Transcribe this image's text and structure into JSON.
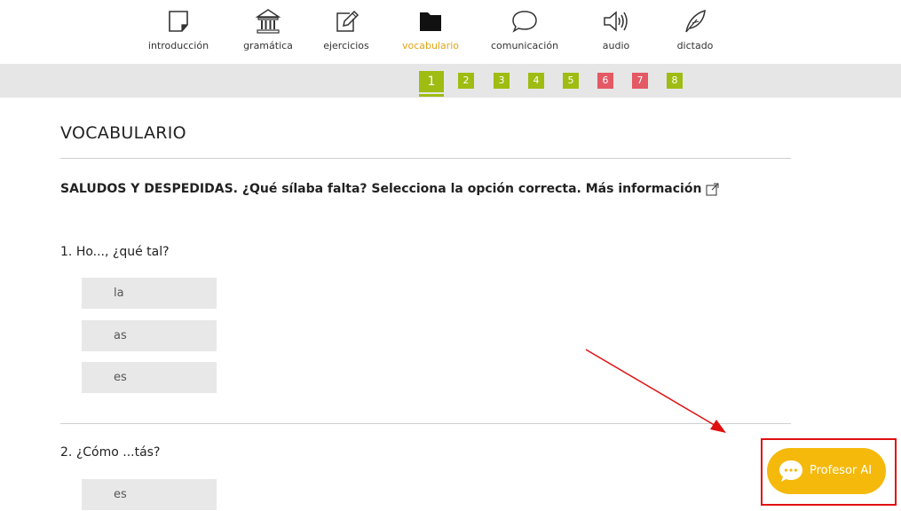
{
  "nav": {
    "items": [
      {
        "label": "introducción",
        "icon": "note-icon",
        "active": false
      },
      {
        "label": "gramática",
        "icon": "building-icon",
        "active": false
      },
      {
        "label": "ejercicios",
        "icon": "pen-icon",
        "active": false
      },
      {
        "label": "vocabulario",
        "icon": "folder-icon",
        "active": true
      },
      {
        "label": "comunicación",
        "icon": "speech-bubble-icon",
        "active": false
      },
      {
        "label": "audio",
        "icon": "speaker-icon",
        "active": false
      },
      {
        "label": "dictado",
        "icon": "feather-icon",
        "active": false
      }
    ]
  },
  "pager": {
    "pages": [
      {
        "label": "1",
        "status": "current"
      },
      {
        "label": "2",
        "status": "green"
      },
      {
        "label": "3",
        "status": "green"
      },
      {
        "label": "4",
        "status": "green"
      },
      {
        "label": "5",
        "status": "green"
      },
      {
        "label": "6",
        "status": "red"
      },
      {
        "label": "7",
        "status": "red"
      },
      {
        "label": "8",
        "status": "green"
      }
    ]
  },
  "content": {
    "title": "VOCABULARIO",
    "instruction": "SALUDOS Y DESPEDIDAS. ¿Qué sílaba falta? Selecciona la opción correcta. Más información",
    "questions": [
      {
        "number": "1.",
        "text": "Ho..., ¿qué tal?",
        "options": [
          "la",
          "as",
          "es"
        ]
      },
      {
        "number": "2.",
        "text": "¿Cómo ...tás?",
        "options": [
          "es"
        ]
      }
    ]
  },
  "ai_button": {
    "label": "Profesor AI",
    "icon": "chat-bubble-icon"
  },
  "colors": {
    "accent_green": "#9ebc12",
    "accent_red": "#e35964",
    "active_nav": "#e0a416",
    "ai_button": "#f5b90c",
    "highlight_box": "#e01010"
  }
}
